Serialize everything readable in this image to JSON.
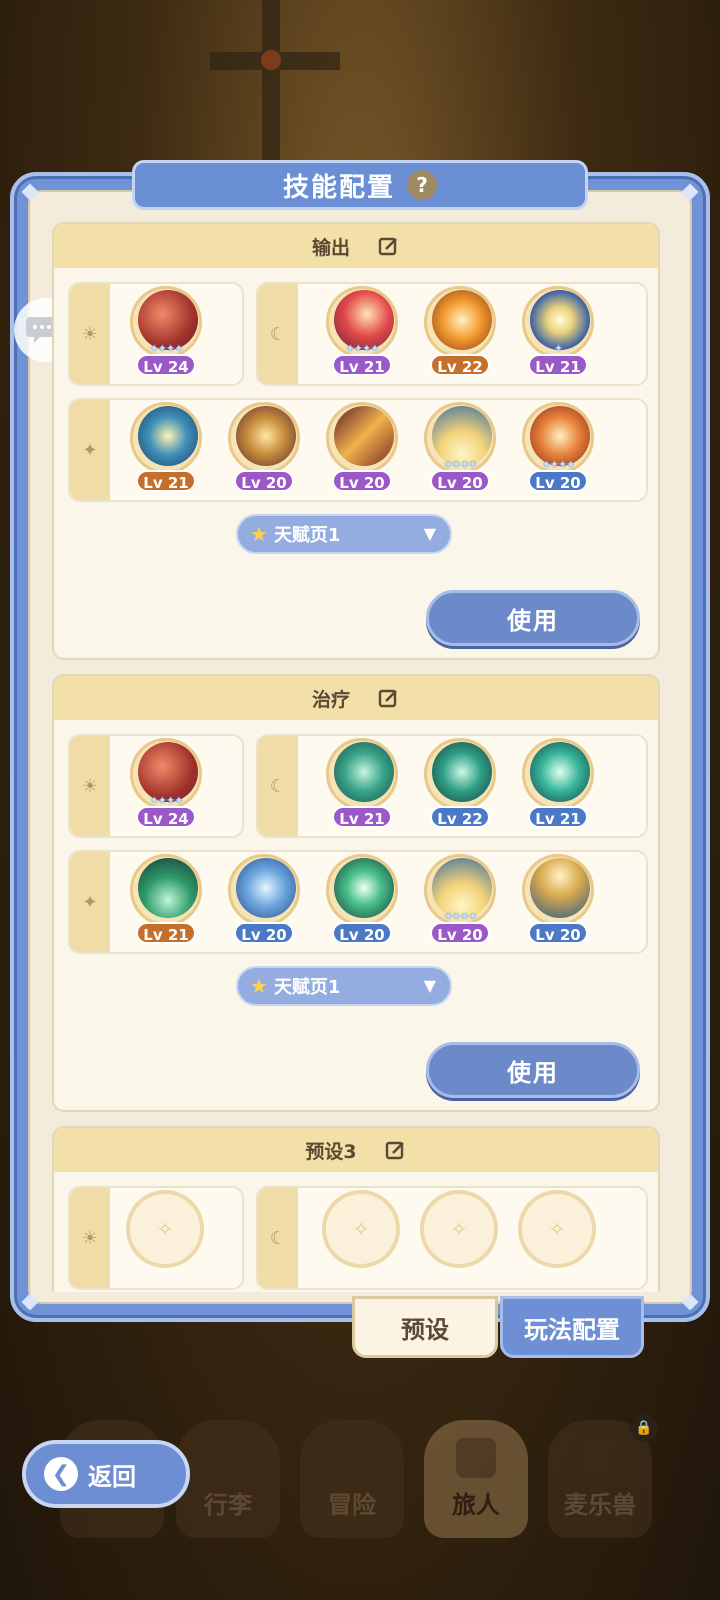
{
  "title": "技能配置",
  "presets": [
    {
      "name": "输出",
      "slots": {
        "sun": [
          {
            "lv": "Lv 24",
            "color": "purple",
            "icon": "red-sweep-skill-icon"
          }
        ],
        "moon": [
          {
            "lv": "Lv 21",
            "color": "purple",
            "icon": "red-orb-skill-icon"
          },
          {
            "lv": "Lv 22",
            "color": "orange",
            "icon": "fire-burst-skill-icon"
          },
          {
            "lv": "Lv 21",
            "color": "purple",
            "icon": "spiral-light-skill-icon"
          }
        ],
        "star": [
          {
            "lv": "Lv 21",
            "color": "orange",
            "icon": "lightning-skill-icon"
          },
          {
            "lv": "Lv 20",
            "color": "purple",
            "icon": "golden-fist-skill-icon"
          },
          {
            "lv": "Lv 20",
            "color": "purple",
            "icon": "slash-skill-icon"
          },
          {
            "lv": "Lv 20",
            "color": "purple",
            "icon": "light-rays-skill-icon"
          },
          {
            "lv": "Lv 20",
            "color": "blue",
            "icon": "explosion-skill-icon"
          }
        ]
      },
      "talent": "天赋页1",
      "use_label": "使用"
    },
    {
      "name": "治疗",
      "slots": {
        "sun": [
          {
            "lv": "Lv 24",
            "color": "purple",
            "icon": "red-sweep-skill-icon"
          }
        ],
        "moon": [
          {
            "lv": "Lv 21",
            "color": "purple",
            "icon": "healing-hand-skill-icon"
          },
          {
            "lv": "Lv 22",
            "color": "blue",
            "icon": "healing-arms-skill-icon"
          },
          {
            "lv": "Lv 21",
            "color": "blue",
            "icon": "healing-wind-skill-icon"
          }
        ],
        "star": [
          {
            "lv": "Lv 21",
            "color": "orange",
            "icon": "green-flame-skill-icon"
          },
          {
            "lv": "Lv 20",
            "color": "blue",
            "icon": "water-fountain-skill-icon"
          },
          {
            "lv": "Lv 20",
            "color": "blue",
            "icon": "green-star-skill-icon"
          },
          {
            "lv": "Lv 20",
            "color": "purple",
            "icon": "light-rays-skill-icon"
          },
          {
            "lv": "Lv 20",
            "color": "blue",
            "icon": "sand-wave-skill-icon"
          }
        ]
      },
      "talent": "天赋页1",
      "use_label": "使用"
    },
    {
      "name": "预设3"
    }
  ],
  "bottom_tabs": {
    "preset": "预设",
    "play_config": "玩法配置"
  },
  "nav": [
    {
      "label": "行李",
      "icon": "luggage-icon"
    },
    {
      "label": "冒险",
      "icon": "crossed-swords-icon"
    },
    {
      "label": "旅人",
      "icon": "traveler-icon"
    },
    {
      "label": "麦乐兽",
      "icon": "cat-icon"
    }
  ],
  "back_label": "返回",
  "colors": {
    "panel": "#6f93d6",
    "purple": "#9b58c7",
    "orange": "#c4702c",
    "blue": "#4b79c6"
  }
}
